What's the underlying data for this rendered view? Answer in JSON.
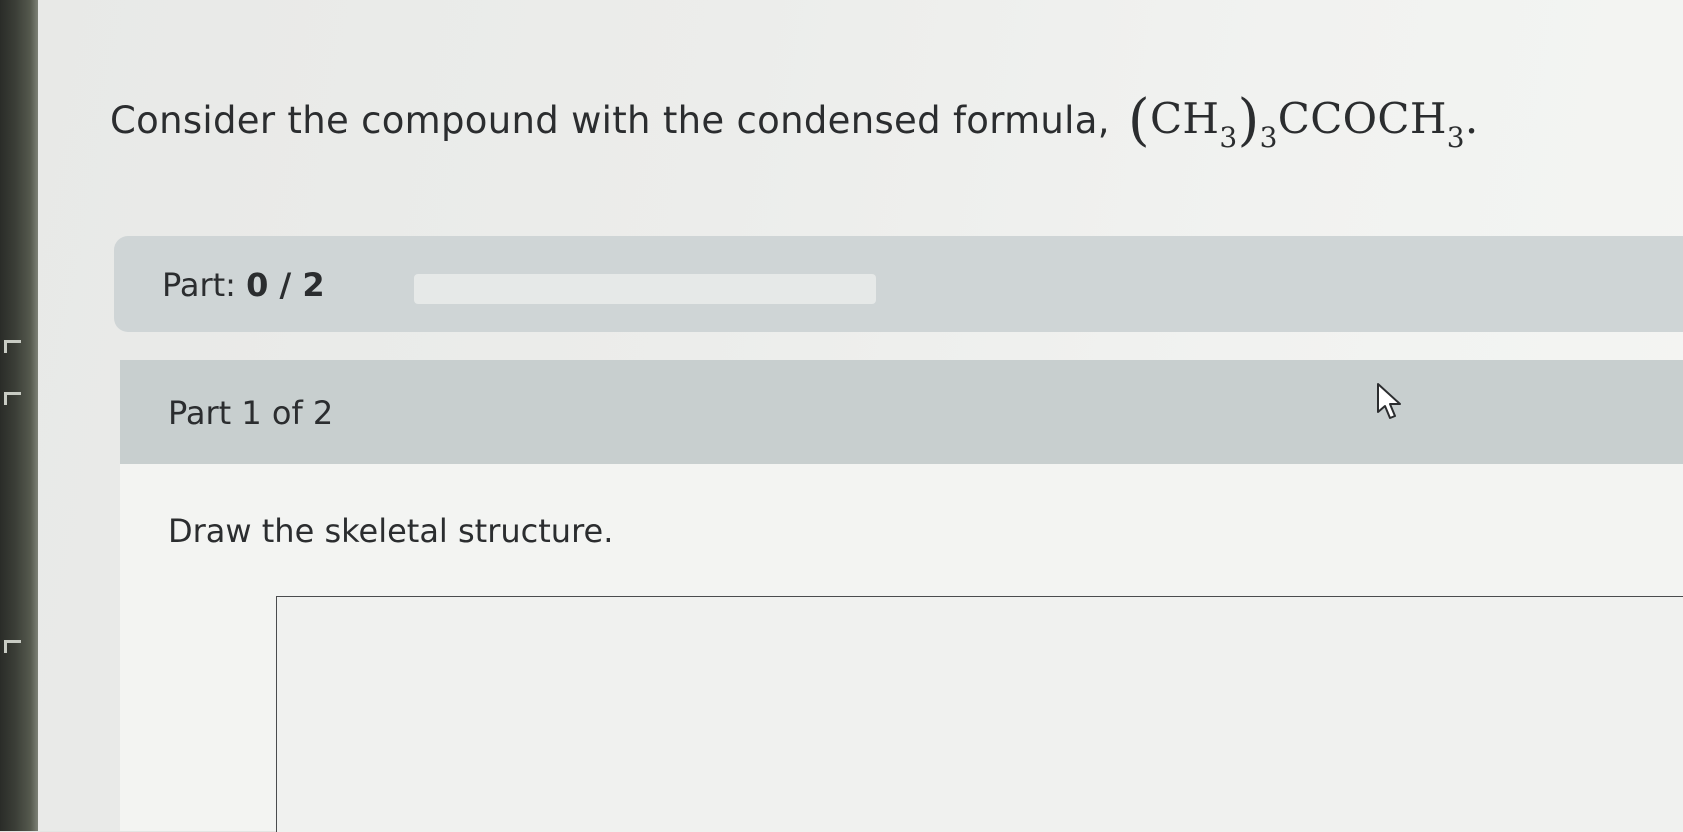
{
  "question": {
    "text": "Consider the compound with the condensed formula,",
    "formula": {
      "open_paren": "(",
      "group": "CH",
      "group_sub": "3",
      "close_paren": ")",
      "group_count": "3",
      "rest": "CCOCH",
      "rest_sub": "3",
      "end": "."
    }
  },
  "progress": {
    "label": "Part:",
    "count": "0 / 2",
    "fraction": 0
  },
  "part": {
    "header": "Part 1 of 2",
    "instruction": "Draw the skeletal structure."
  },
  "icons": {
    "cursor": "mouse-pointer-icon"
  },
  "colors": {
    "progress_band": "#cfd5d6",
    "part_header": "#c8cfcf",
    "text": "#2b2d2f"
  }
}
